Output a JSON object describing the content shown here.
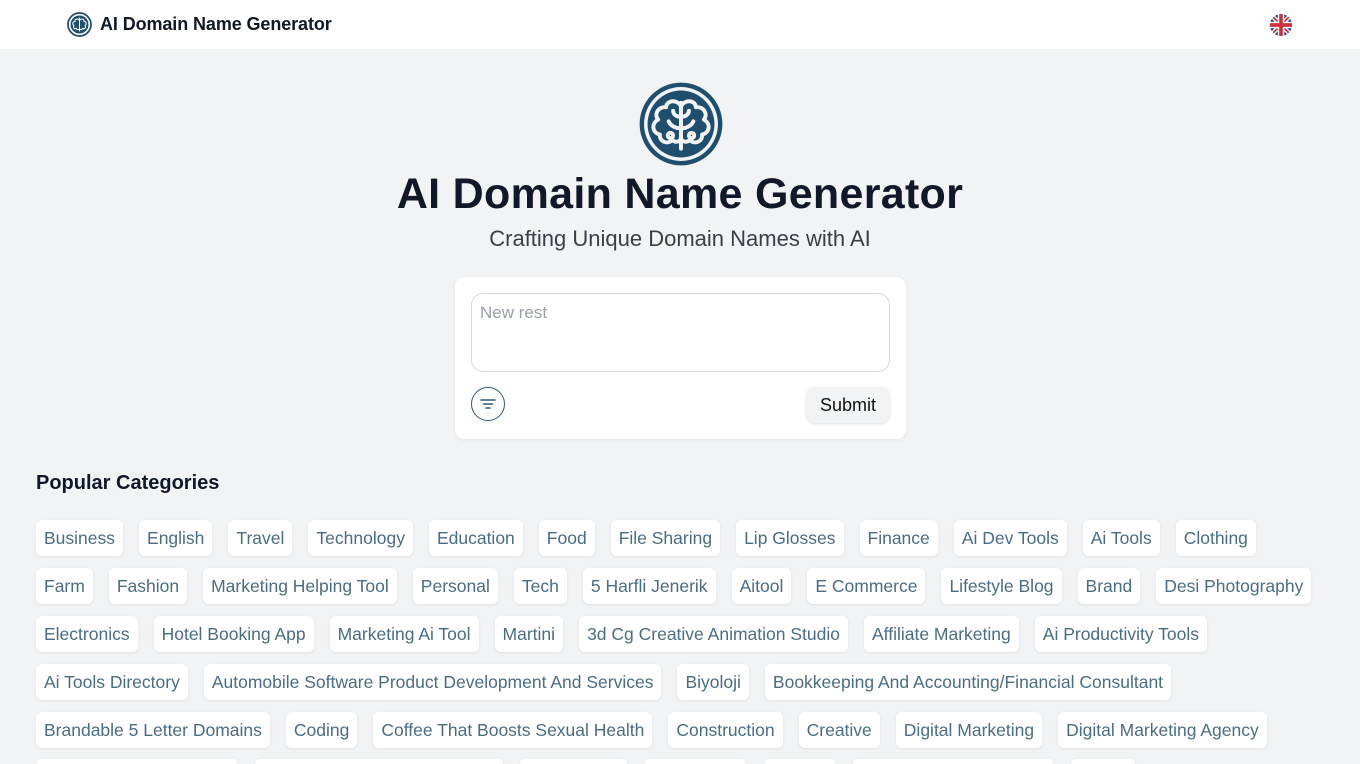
{
  "header": {
    "brand_name": "AI Domain Name Generator",
    "logo_icon": "brain-icon",
    "language_icon": "uk-flag-icon"
  },
  "hero": {
    "logo_icon": "brain-icon",
    "title": "AI Domain Name Generator",
    "subtitle": "Crafting Unique Domain Names with AI"
  },
  "form": {
    "prompt_value": "",
    "prompt_placeholder": "New rest",
    "filter_icon": "filter-icon",
    "submit_label": "Submit"
  },
  "categories": {
    "title": "Popular Categories",
    "items": [
      "Business",
      "English",
      "Travel",
      "Technology",
      "Education",
      "Food",
      "File Sharing",
      "Lip Glosses",
      "Finance",
      "Ai Dev Tools",
      "Ai Tools",
      "Clothing",
      "Farm",
      "Fashion",
      "Marketing Helping Tool",
      "Personal",
      "Tech",
      "5 Harfli Jenerik",
      "Aitool",
      "E Commerce",
      "Lifestyle Blog",
      "Brand",
      "Desi Photography",
      "Electronics",
      "Hotel Booking App",
      "Marketing Ai Tool",
      "Martini",
      "3d Cg Creative Animation Studio",
      "Affiliate Marketing",
      "Ai Productivity Tools",
      "Ai Tools Directory",
      "Automobile Software Product Development And Services",
      "Biyoloji",
      "Bookkeeping And Accounting/Financial Consultant",
      "Brandable 5 Letter Domains",
      "Coding",
      "Coffee That Boosts Sexual Health",
      "Construction",
      "Creative",
      "Digital Marketing",
      "Digital Marketing Agency"
    ]
  },
  "colors": {
    "page_bg": "#f2f3f5",
    "header_bg": "#ffffff",
    "brand_blue": "#1f4e6e",
    "tag_text": "#4b6d84",
    "title_text": "#111827"
  }
}
